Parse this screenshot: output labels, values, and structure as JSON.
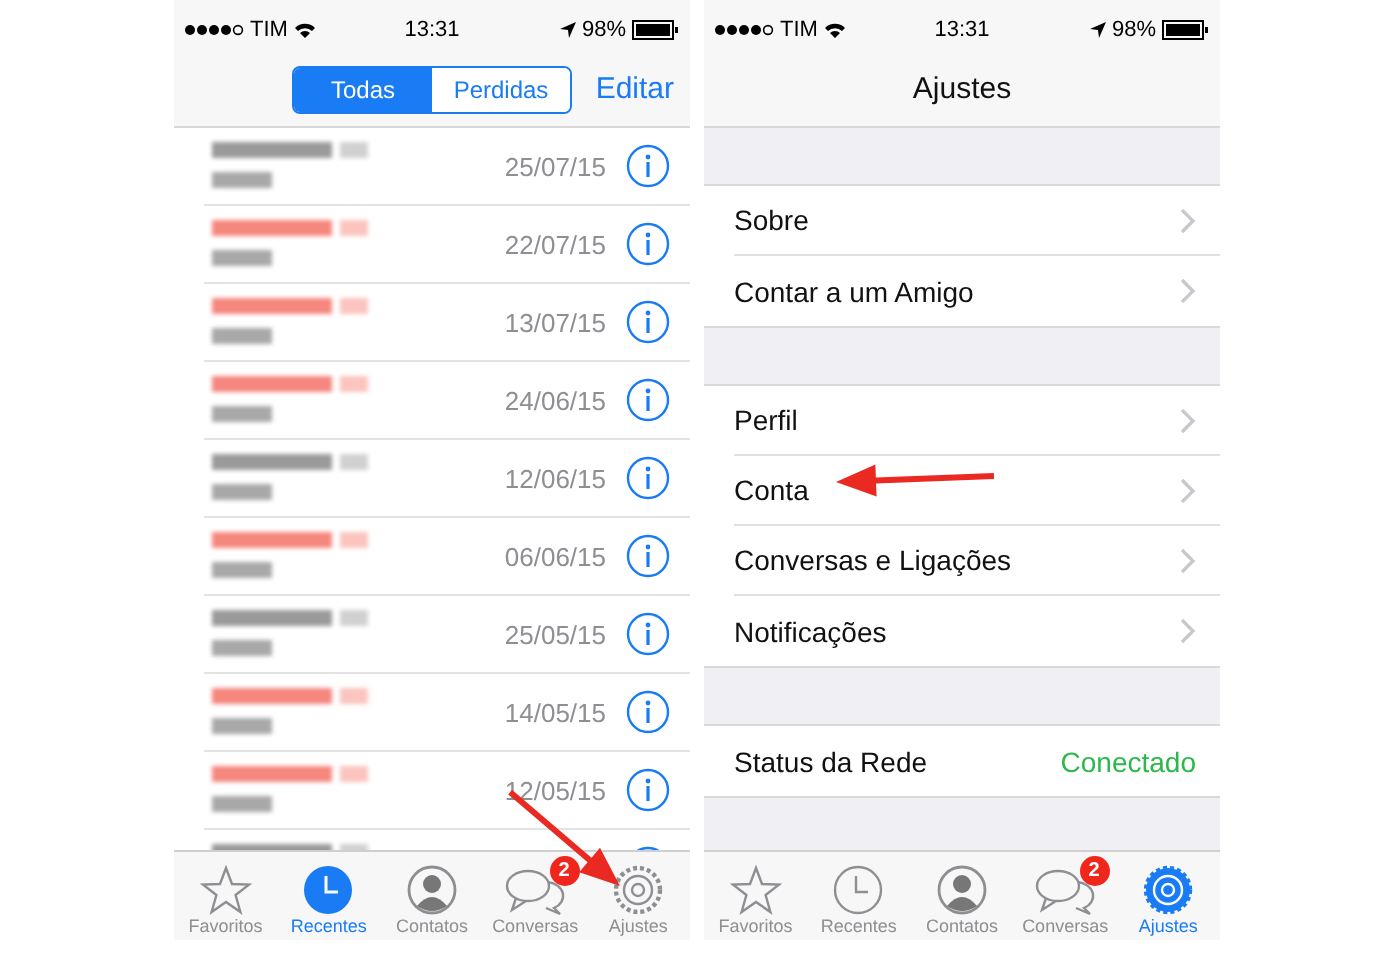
{
  "phones": [
    {
      "kind": "calls",
      "status_bar": {
        "carrier": "TIM",
        "time": "13:31",
        "battery": "98%"
      },
      "nav": {
        "segments": [
          {
            "label": "Todas",
            "selected": true
          },
          {
            "label": "Perdidas",
            "selected": false
          }
        ],
        "action": "Editar"
      },
      "calls": [
        {
          "missed": false,
          "date": "25/07/15"
        },
        {
          "missed": true,
          "date": "22/07/15"
        },
        {
          "missed": true,
          "date": "13/07/15"
        },
        {
          "missed": true,
          "date": "24/06/15"
        },
        {
          "missed": false,
          "date": "12/06/15"
        },
        {
          "missed": true,
          "date": "06/06/15"
        },
        {
          "missed": false,
          "date": "25/05/15"
        },
        {
          "missed": true,
          "date": "14/05/15"
        },
        {
          "missed": true,
          "date": "12/05/15"
        },
        {
          "missed": false
        }
      ],
      "tab_bar": [
        {
          "kind": "star",
          "label": "Favoritos",
          "selected": false
        },
        {
          "kind": "clock",
          "label": "Recentes",
          "selected": true
        },
        {
          "kind": "person",
          "label": "Contatos",
          "selected": false
        },
        {
          "kind": "chat",
          "label": "Conversas",
          "selected": false,
          "badge": "2"
        },
        {
          "kind": "gear",
          "label": "Ajustes",
          "selected": false
        }
      ]
    },
    {
      "kind": "settings",
      "status_bar": {
        "carrier": "TIM",
        "time": "13:31",
        "battery": "98%"
      },
      "nav": {
        "title": "Ajustes"
      },
      "sections": [
        [
          {
            "kind": "link",
            "label": "Sobre"
          },
          {
            "kind": "link",
            "label": "Contar a um Amigo"
          }
        ],
        [
          {
            "kind": "link",
            "label": "Perfil"
          },
          {
            "kind": "link",
            "label": "Conta"
          },
          {
            "kind": "link",
            "label": "Conversas e Ligações"
          },
          {
            "kind": "link",
            "label": "Notificações"
          }
        ],
        [
          {
            "kind": "status",
            "label": "Status da Rede",
            "value": "Conectado"
          }
        ]
      ],
      "tab_bar": [
        {
          "kind": "star",
          "label": "Favoritos",
          "selected": false
        },
        {
          "kind": "clock",
          "label": "Recentes",
          "selected": false
        },
        {
          "kind": "person",
          "label": "Contatos",
          "selected": false
        },
        {
          "kind": "chat",
          "label": "Conversas",
          "selected": false,
          "badge": "2"
        },
        {
          "kind": "gear",
          "label": "Ajustes",
          "selected": true
        }
      ]
    }
  ]
}
